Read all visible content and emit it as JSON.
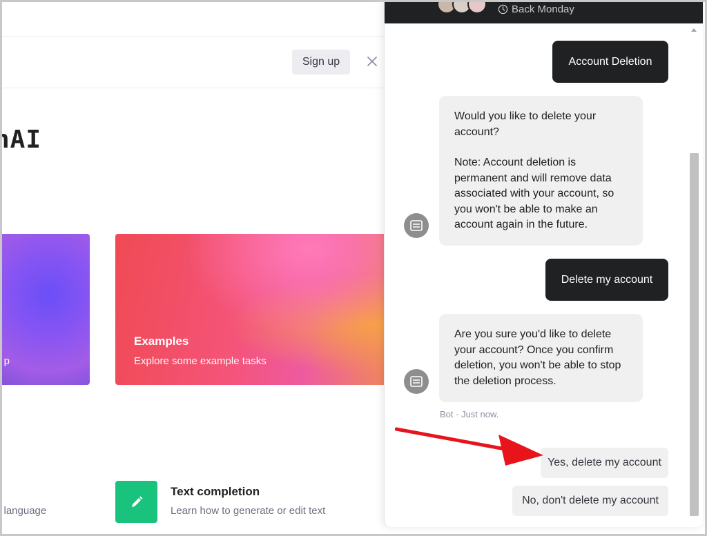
{
  "page": {
    "brand_fragment": "nAI",
    "signup_label": "Sign up",
    "cards": {
      "left_fragment": "p",
      "examples_title": "Examples",
      "examples_subtitle": "Explore some example tasks"
    },
    "bottom": {
      "left_fragment": "l language",
      "text_completion_title": "Text completion",
      "text_completion_subtitle": "Learn how to generate or edit text"
    },
    "colors": {
      "text_completion_icon_bg": "#19c37d",
      "signup_bg": "#ececf1"
    }
  },
  "chat": {
    "header_status": "Back Monday",
    "messages": {
      "user_1": "Account Deletion",
      "bot_1": [
        "Would you like to delete your account?",
        "",
        "Note: Account deletion is permanent and will remove data associated with your account, so you won't be able to make an account again in the future."
      ],
      "user_2": "Delete my account",
      "bot_2": "Are you sure you'd like to delete your account? Once you confirm deletion, you won't be able to stop the deletion process."
    },
    "bot_meta": "Bot · Just now.",
    "replies": {
      "yes": "Yes, delete my account",
      "no": "No, don't delete my account"
    },
    "colors": {
      "header_bg": "#202123",
      "user_bubble_bg": "#202123",
      "bot_bubble_bg": "#f0f0f0",
      "annotation_arrow": "#e8141c"
    },
    "icons": [
      "clock-icon",
      "bot-icon",
      "close-icon"
    ]
  }
}
